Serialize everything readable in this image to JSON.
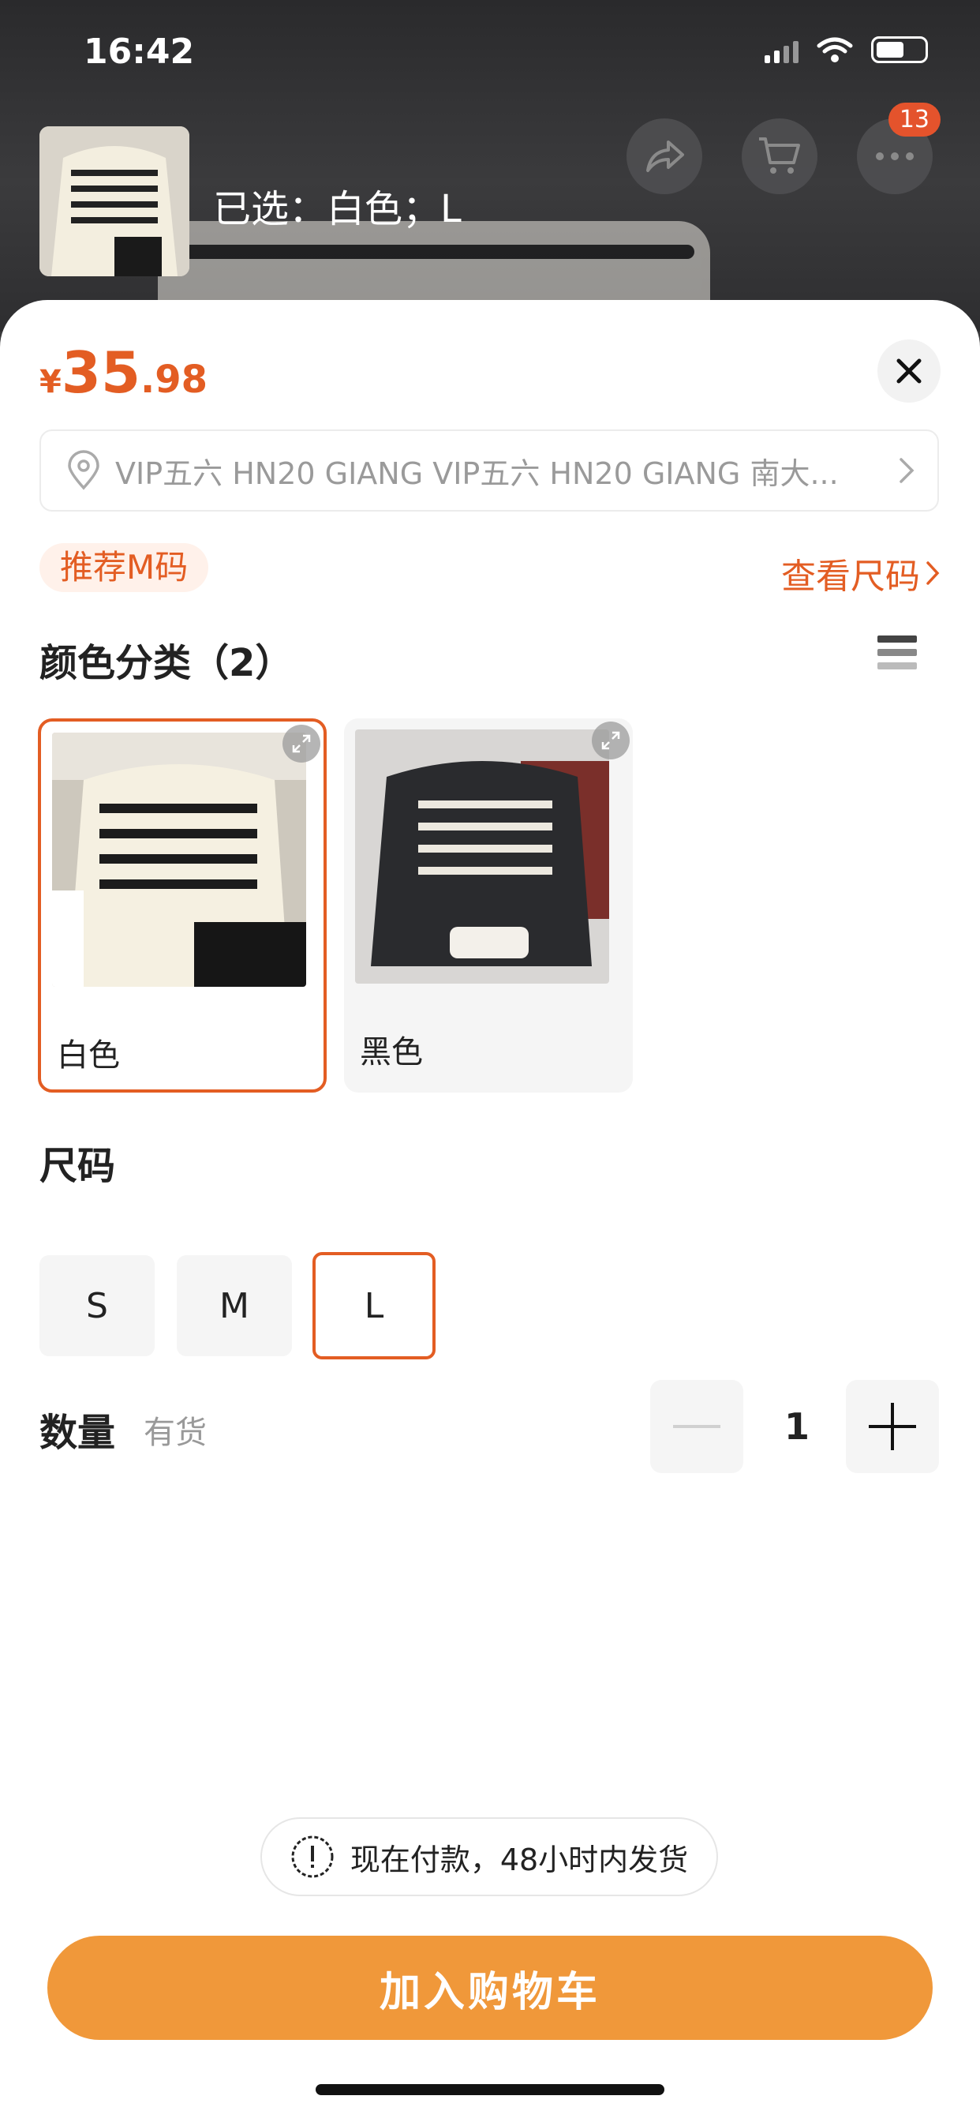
{
  "status_bar": {
    "time": "16:42"
  },
  "header": {
    "selected_text": "已选：白色；L",
    "cart_badge": "13"
  },
  "sheet": {
    "price": {
      "symbol": "¥",
      "integer": "35",
      "decimal": ".98"
    },
    "address": "VIP五六 HN20 GIANG VIP五六 HN20 GIANG 南大...",
    "recommend_tag": "推荐M码",
    "size_guide_label": "查看尺码",
    "color_section_title": "颜色分类（2）",
    "colors": [
      {
        "name": "白色",
        "selected": true
      },
      {
        "name": "黑色",
        "selected": false
      }
    ],
    "size_section_title": "尺码",
    "sizes": [
      {
        "label": "S",
        "selected": false
      },
      {
        "label": "M",
        "selected": false
      },
      {
        "label": "L",
        "selected": true
      }
    ],
    "quantity_title": "数量",
    "stock_text": "有货",
    "quantity": "1",
    "notice": "现在付款，48小时内发货",
    "add_to_cart_label": "加入购物车"
  },
  "colors": {
    "accent": "#e35d23",
    "cta": "#f0983a"
  }
}
